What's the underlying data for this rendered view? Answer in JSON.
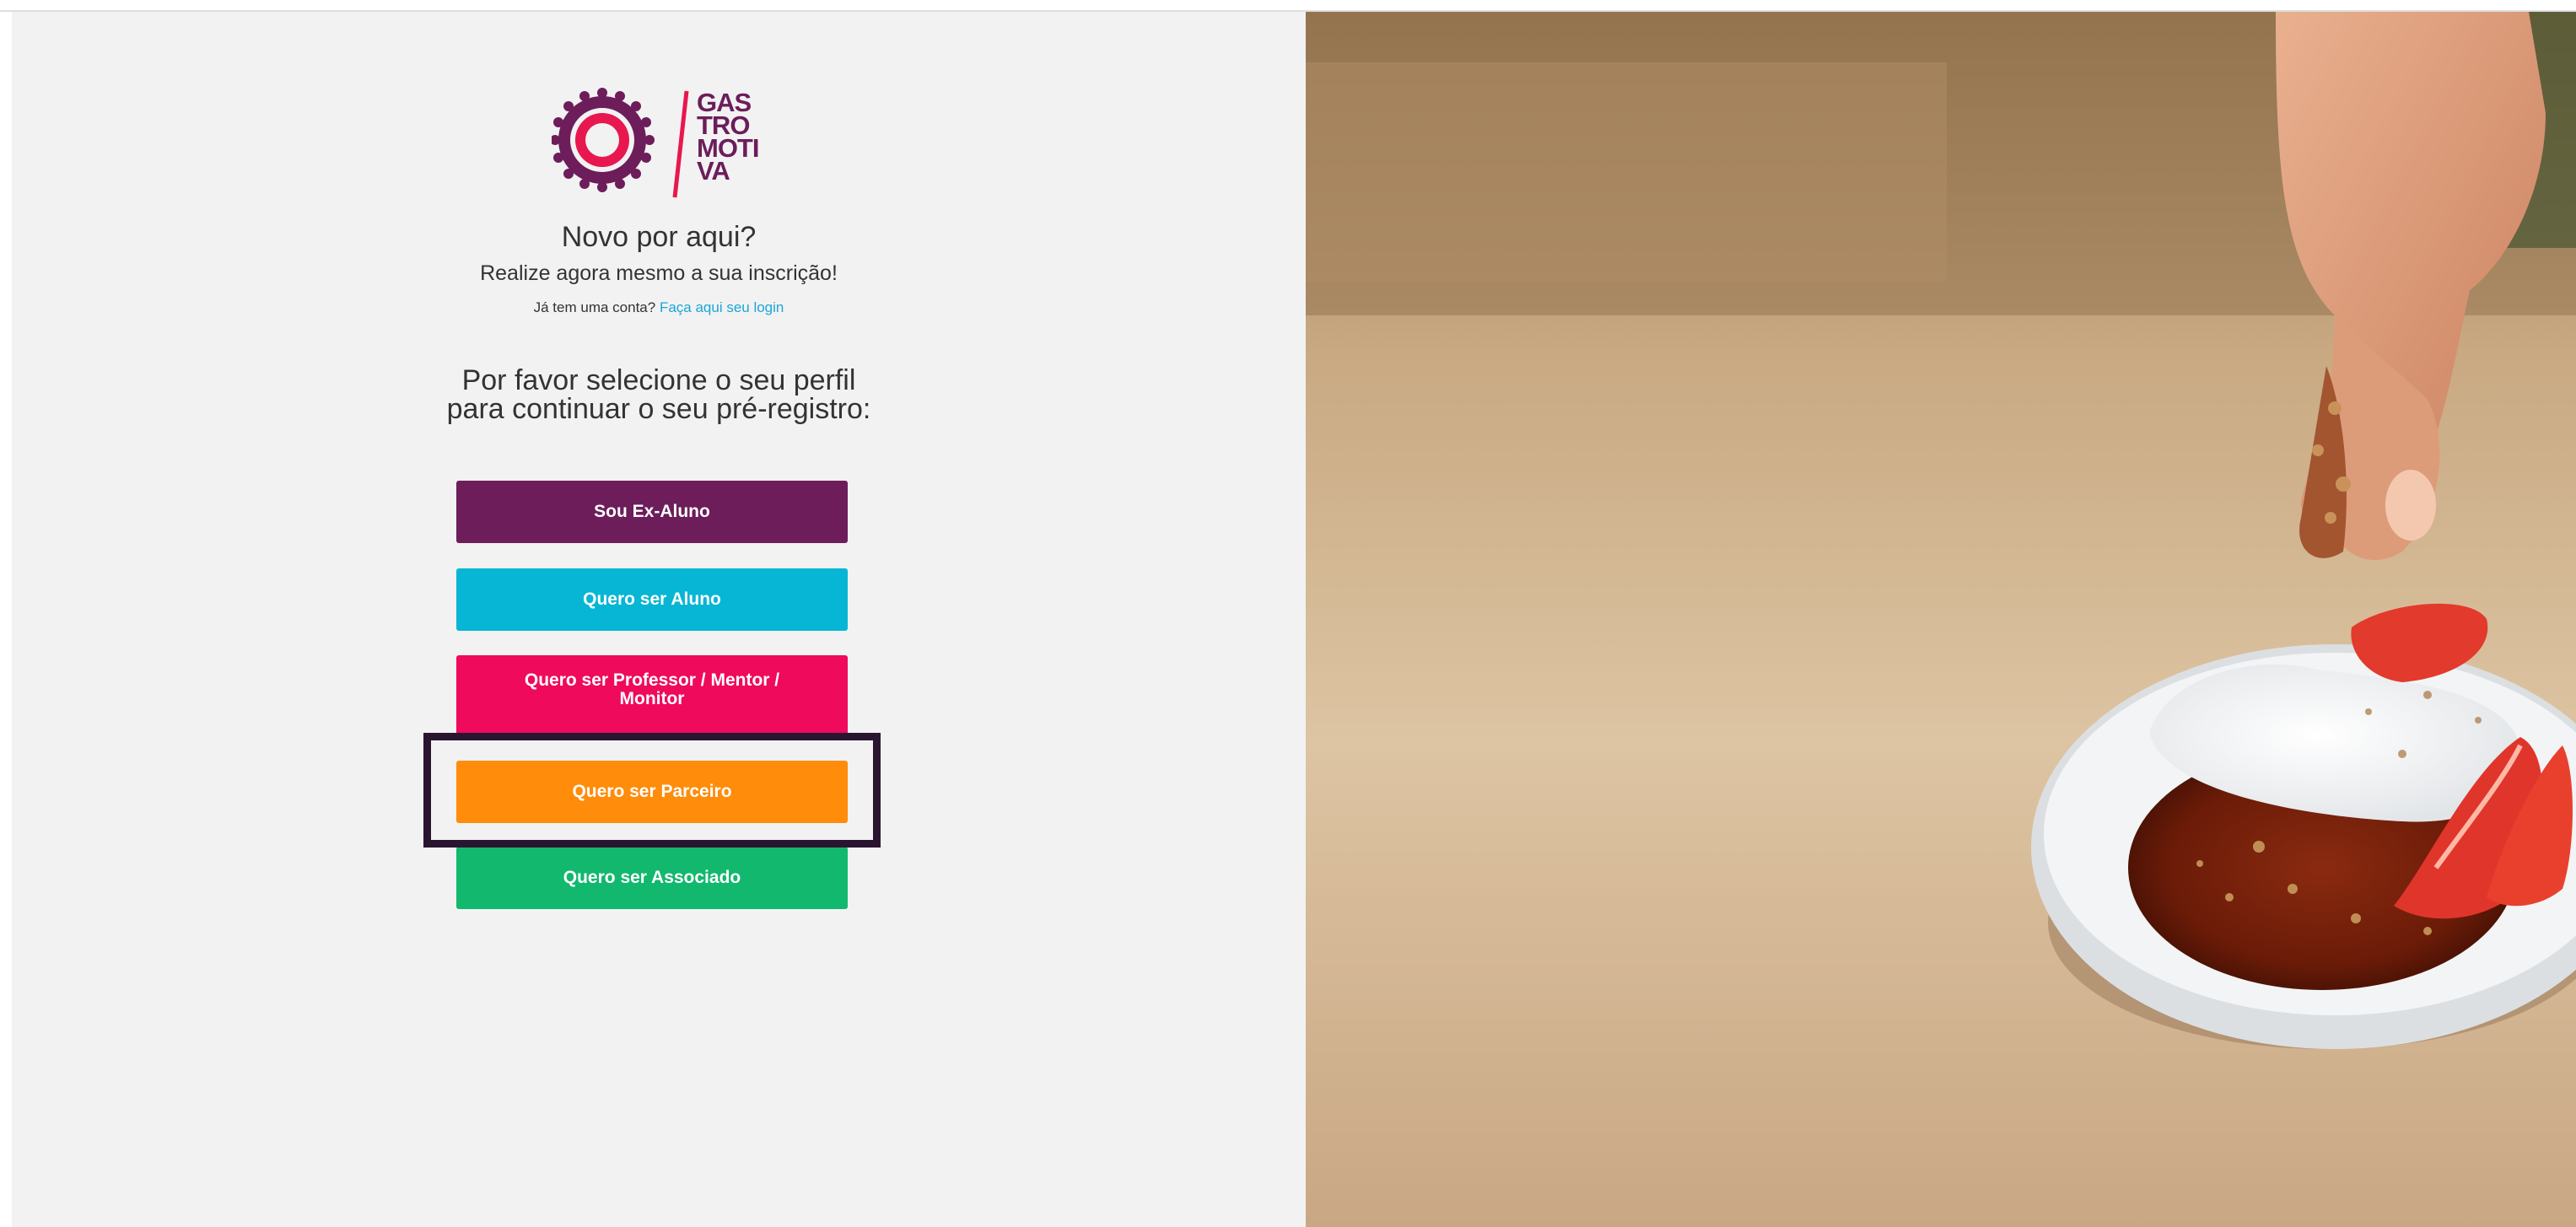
{
  "logo": {
    "lines": [
      "GAS",
      "TRO",
      "MOTI",
      "VA"
    ]
  },
  "intro": {
    "title": "Novo por aqui?",
    "subtitle": "Realize agora mesmo a sua inscrição!",
    "have_account": "Já tem uma conta?",
    "login_link": "Faça aqui seu login"
  },
  "profile_prompt": {
    "line1": "Por favor selecione o seu perfil",
    "line2": "para continuar o seu pré-registro:"
  },
  "buttons": [
    {
      "label": "Sou Ex-Aluno",
      "color": "#6c1d5a"
    },
    {
      "label": "Quero ser Aluno",
      "color": "#06b6d4"
    },
    {
      "label": "Quero ser Professor / Mentor / Monitor",
      "color": "#ef0a5b"
    },
    {
      "label": "Quero ser Parceiro",
      "color": "#ff8c0a"
    },
    {
      "label": "Quero ser Associado",
      "color": "#12b86d"
    }
  ],
  "colors": {
    "brand_purple": "#6c1d5a",
    "brand_pink": "#e8174f",
    "link_blue": "#1aa6d8",
    "highlight_border": "#2a1530"
  },
  "photo": {
    "icon": "dessert-photo"
  }
}
